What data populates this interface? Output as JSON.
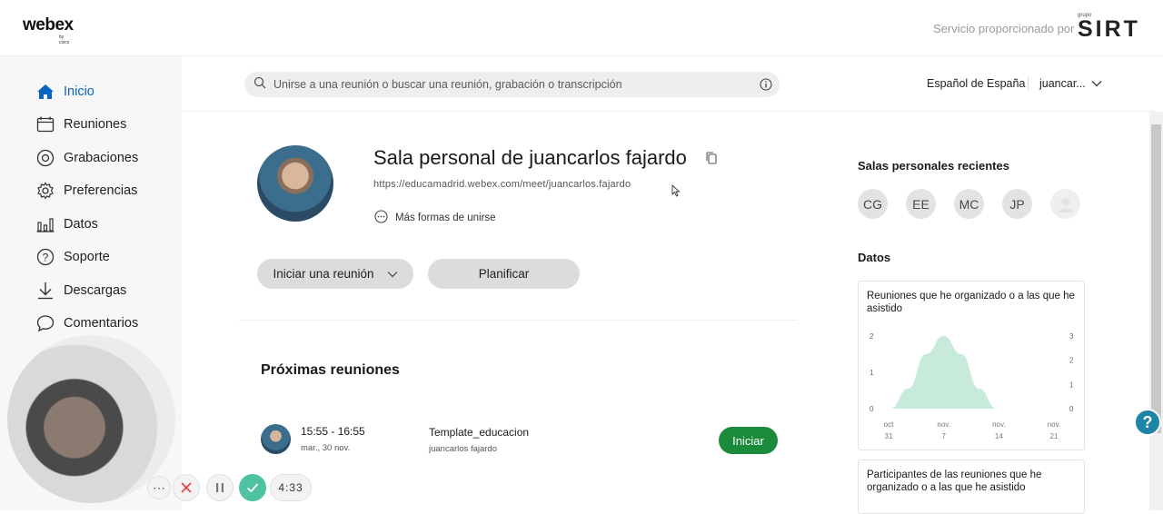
{
  "brand": {
    "logo_text": "webex",
    "logo_sub": "by cisco",
    "provided_by": "Servicio proporcionado por",
    "partner_group": "grupo",
    "partner_name": "SIRT"
  },
  "sidebar": {
    "items": [
      {
        "label": "Inicio",
        "icon": "home-icon",
        "active": true
      },
      {
        "label": "Reuniones",
        "icon": "calendar-icon"
      },
      {
        "label": "Grabaciones",
        "icon": "recording-icon"
      },
      {
        "label": "Preferencias",
        "icon": "gear-icon"
      },
      {
        "label": "Datos",
        "icon": "bar-chart-icon"
      },
      {
        "label": "Soporte",
        "icon": "help-icon"
      },
      {
        "label": "Descargas",
        "icon": "download-icon"
      },
      {
        "label": "Comentarios",
        "icon": "comment-icon"
      }
    ]
  },
  "search": {
    "placeholder": "Unirse a una reunión o buscar una reunión, grabación o transcripción"
  },
  "header": {
    "language": "Español de España",
    "user": "juancar..."
  },
  "room": {
    "title": "Sala personal de juancarlos fajardo",
    "url": "https://educamadrid.webex.com/meet/juancarlos.fajardo",
    "more_ways": "Más formas de unirse",
    "start_button": "Iniciar una reunión",
    "plan_button": "Planificar"
  },
  "upcoming": {
    "title": "Próximas reuniones",
    "meeting": {
      "time": "15:55 - 16:55",
      "date": "mar., 30 nov.",
      "name": "Template_educacion",
      "host": "juancarlos fajardo",
      "start_label": "Iniciar"
    }
  },
  "recent": {
    "title": "Salas personales recientes",
    "chips": [
      "CG",
      "EE",
      "MC",
      "JP",
      ""
    ]
  },
  "datos": {
    "title": "Datos",
    "card1_title": "Reuniones que he organizado o a las que he asistido",
    "card2_title": "Participantes de las reuniones que he organizado o a las que he asistido"
  },
  "chart_data": {
    "type": "area",
    "title": "Reuniones que he organizado o a las que he asistido",
    "x_ticks": [
      "oct\n31",
      "nov.\n7",
      "nov.\n14",
      "nov.\n21"
    ],
    "x_ticks_top": [
      "oct",
      "nov.",
      "nov.",
      "nov."
    ],
    "x_ticks_bottom": [
      "31",
      "7",
      "14",
      "21"
    ],
    "y_left_ticks": [
      0,
      1,
      2
    ],
    "y_right_ticks": [
      0,
      1,
      2,
      3
    ],
    "ylim": [
      0,
      2
    ],
    "series": [
      {
        "x": [
          0,
          0.5,
          1,
          1.5,
          2,
          2.5,
          3
        ],
        "values": [
          0,
          0.55,
          1.5,
          2,
          1.5,
          0.55,
          0
        ]
      }
    ],
    "color": "#c8eadb"
  },
  "recording": {
    "timer": "4:33"
  },
  "help": {
    "label": "?"
  }
}
